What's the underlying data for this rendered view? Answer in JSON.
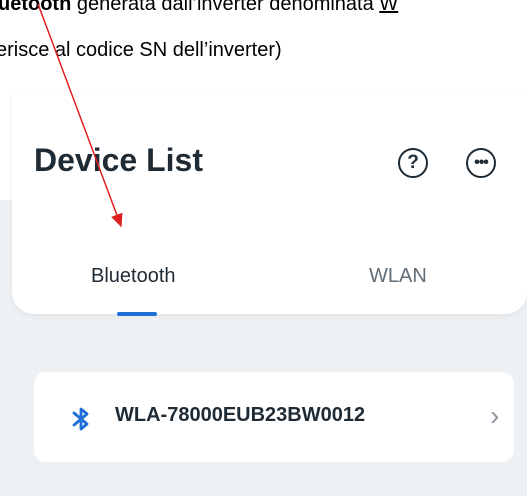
{
  "document": {
    "line1_bold": "uetooth",
    "line1_rest": " generata dall’inverter denominata ",
    "line1_underlined": "W",
    "line2": "erisce al codice SN dell’inverter)"
  },
  "app": {
    "title": "Device List",
    "help_icon_glyph": "?",
    "more_icon_glyph": "•••",
    "tabs": [
      {
        "label": "Bluetooth",
        "selected": true
      },
      {
        "label": "WLAN",
        "selected": false
      }
    ],
    "devices": [
      {
        "name": "WLA-78000EUB23BW0012",
        "icon": "bluetooth-icon"
      }
    ],
    "chevron": "›"
  },
  "colors": {
    "accent": "#1f6fd8",
    "annotation_arrow": "#e02020",
    "background": "#eef1f3",
    "text": "#1e2a34"
  }
}
